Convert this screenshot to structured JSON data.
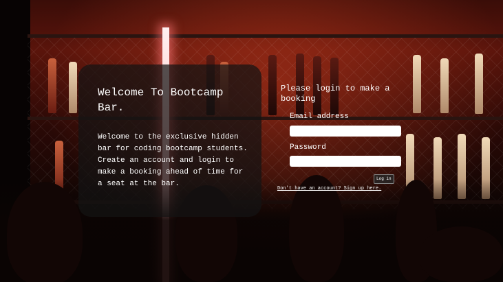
{
  "welcome": {
    "title": "Welcome To Bootcamp Bar.",
    "description": "Welcome to the exclusive hidden bar for coding bootcamp students. Create an account and login to make a booking ahead of time for a seat at the bar."
  },
  "login": {
    "heading": "Please login to make a booking",
    "email_label": "Email address",
    "email_value": "",
    "password_label": "Password",
    "password_value": "",
    "login_button": "Log in",
    "signup_link": "Don't have an account? Sign up here."
  }
}
